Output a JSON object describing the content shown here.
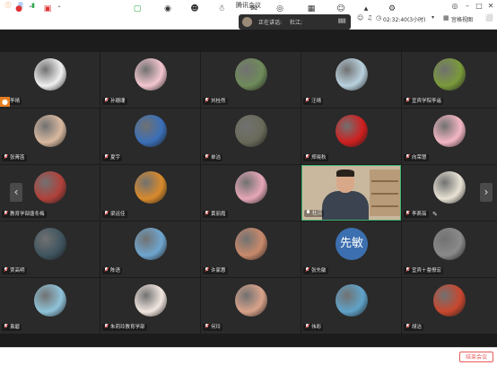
{
  "window": {
    "title": "腾讯会议",
    "status_icons": [
      "info-icon",
      "shield-icon",
      "signal-icon"
    ]
  },
  "toolbar": {
    "speaking_label": "正在讲话:",
    "speaking_name": "杜江;",
    "time": "02:32:40(3小时)",
    "view_label": "宫格视图"
  },
  "grid": {
    "rows": [
      [
        {
          "name": "李晴",
          "avatar": "cartoon-girl",
          "color": "#f0f0f0"
        },
        {
          "name": "孙珊珊",
          "avatar": "pink-flower",
          "color": "#f3c6cf"
        },
        {
          "name": "刘桂然",
          "avatar": "landscape",
          "color": "#6f8b5a"
        },
        {
          "name": "汪晴",
          "avatar": "girl-sky",
          "color": "#b9d2df"
        },
        {
          "name": "宜宾学院李遥",
          "avatar": "green-creature",
          "color": "#7a9a3a"
        }
      ],
      [
        {
          "name": "张菁菡",
          "avatar": "girl-camera",
          "color": "#d9b9a0"
        },
        {
          "name": "夏宇",
          "avatar": "blue-sky",
          "color": "#3a6fb8"
        },
        {
          "name": "单洁",
          "avatar": "man-photo",
          "color": "#6a6a5a"
        },
        {
          "name": "郑晓秋",
          "avatar": "red-cartoon",
          "color": "#d01f1f"
        },
        {
          "name": "向荣慧",
          "avatar": "pink-cartoon",
          "color": "#f4b7c4"
        }
      ],
      [
        {
          "name": "教育学部唐冬梅",
          "avatar": "red-flowers",
          "color": "#b0413a"
        },
        {
          "name": "梁运佳",
          "avatar": "sunset",
          "color": "#d98a2b"
        },
        {
          "name": "黄丽霞",
          "avatar": "pink-flowers",
          "color": "#e6a7b8"
        },
        {
          "name": "杜江",
          "avatar": "video",
          "color": "#c9b89e"
        },
        {
          "name": "李燕茹",
          "avatar": "cat-white",
          "color": "#e9e3d5"
        }
      ],
      [
        {
          "name": "贾高明",
          "avatar": "dark-sky",
          "color": "#3f5560"
        },
        {
          "name": "陈语",
          "avatar": "sea-sky",
          "color": "#6fa6cf"
        },
        {
          "name": "许家惠",
          "avatar": "sunset-field",
          "color": "#c98a6b"
        },
        {
          "name": "张先敏",
          "avatar": "text",
          "text": "先敏",
          "color": "#3c6fb0"
        },
        {
          "name": "宜宾十耋僚宏",
          "avatar": "calligraphy",
          "color": "#8a8a8a"
        }
      ],
      [
        {
          "name": "袁碧",
          "avatar": "beach-girl",
          "color": "#8fc3d9"
        },
        {
          "name": "朱莉玲教育学部",
          "avatar": "anime-girl",
          "color": "#f2e6e0"
        },
        {
          "name": "何玲",
          "avatar": "girl-face",
          "color": "#d9a38a"
        },
        {
          "name": "伟彩",
          "avatar": "ocean",
          "color": "#5fa3c9"
        },
        {
          "name": "胡洁",
          "avatar": "red-fruit",
          "color": "#c9472e"
        }
      ]
    ]
  },
  "bottom": {
    "end_label": "结束会议",
    "icons": [
      "mic-muted-icon",
      "camera-muted-icon",
      "share-screen-icon",
      "security-icon",
      "members-icon",
      "chat-icon",
      "record-icon",
      "apps-icon",
      "reactions-icon",
      "settings-icon"
    ]
  }
}
